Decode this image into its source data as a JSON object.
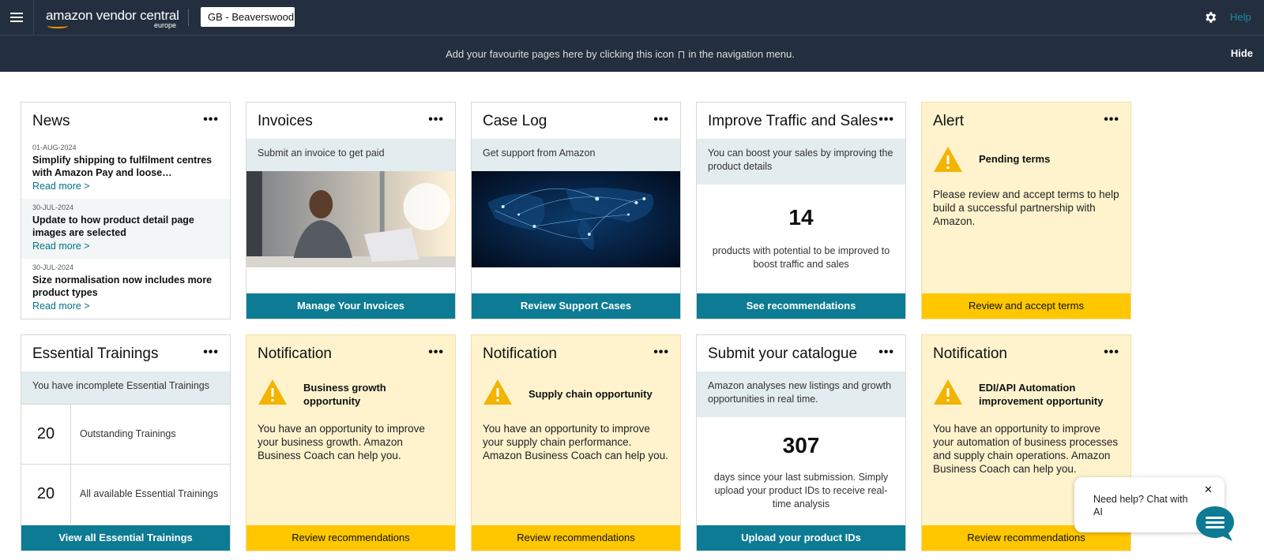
{
  "header": {
    "logo_main": "amazon vendor central",
    "logo_sub": "europe",
    "account": "GB - Beaverswood",
    "help": "Help"
  },
  "favbar": {
    "msg_before": "Add your favourite pages here by clicking this icon",
    "msg_after": "in the navigation menu.",
    "hide": "Hide"
  },
  "cards": {
    "news": {
      "title": "News",
      "items": [
        {
          "date": "01-AUG-2024",
          "title": "Simplify shipping to fulfilment centres with Amazon Pay and loose…",
          "link": "Read more >"
        },
        {
          "date": "30-JUL-2024",
          "title": "Update to how product detail page images are selected",
          "link": "Read more >"
        },
        {
          "date": "30-JUL-2024",
          "title": "Size normalisation now includes more product types",
          "link": "Read more >"
        }
      ]
    },
    "invoices": {
      "title": "Invoices",
      "sub": "Submit an invoice to get paid",
      "button": "Manage Your Invoices"
    },
    "caselog": {
      "title": "Case Log",
      "sub": "Get support from Amazon",
      "button": "Review Support Cases"
    },
    "traffic": {
      "title": "Improve Traffic and Sales",
      "sub": "You can boost your sales by improving the product details",
      "count": "14",
      "caption": "products with potential to be improved to boost traffic and sales",
      "button": "See recommendations"
    },
    "alert": {
      "title": "Alert",
      "heading": "Pending terms",
      "body": "Please review and accept terms to help build a successful partnership with Amazon.",
      "button": "Review and accept terms"
    },
    "trainings": {
      "title": "Essential Trainings",
      "sub": "You have incomplete Essential Trainings",
      "rows": [
        {
          "count": "20",
          "label": "Outstanding Trainings"
        },
        {
          "count": "20",
          "label": "All available Essential Trainings"
        }
      ],
      "button": "View all Essential Trainings"
    },
    "notif1": {
      "title": "Notification",
      "heading": "Business growth opportunity",
      "body": "You have an opportunity to improve your business growth. Amazon Business Coach can help you.",
      "button": "Review recommendations"
    },
    "notif2": {
      "title": "Notification",
      "heading": "Supply chain opportunity",
      "body": "You have an opportunity to improve your supply chain performance. Amazon Business Coach can help you.",
      "button": "Review recommendations"
    },
    "catalogue": {
      "title": "Submit your catalogue",
      "sub": "Amazon analyses new listings and growth opportunities in real time.",
      "count": "307",
      "caption": "days since your last submission. Simply upload your product IDs to receive real-time analysis",
      "button": "Upload your product IDs"
    },
    "notif3": {
      "title": "Notification",
      "heading": "EDI/API Automation improvement opportunity",
      "body": "You have an opportunity to improve your automation of business processes and supply chain operations. Amazon Business Coach can help you.",
      "button": "Review recommendations"
    }
  },
  "chat": {
    "message": "Need help? Chat with AI",
    "close": "✕"
  },
  "menu_dots": "•••"
}
